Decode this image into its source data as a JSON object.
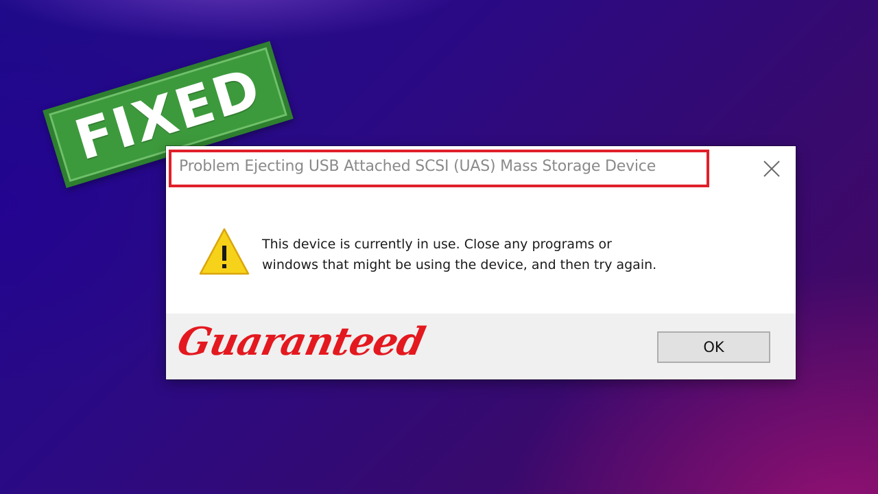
{
  "stamp": {
    "text": "FIXED",
    "color": "#3d9a3c"
  },
  "dialog": {
    "title": "Problem Ejecting USB Attached SCSI (UAS) Mass Storage Device",
    "close_icon": "close-icon",
    "warning_icon": "warning-icon",
    "message_line1": "This device is currently in use. Close any programs or",
    "message_line2": "windows that might be using the device, and then try again.",
    "ok_label": "OK",
    "highlight_color": "#e0202a"
  },
  "overlay": {
    "signature_text": "Guaranteed",
    "signature_color": "#e3191f"
  }
}
